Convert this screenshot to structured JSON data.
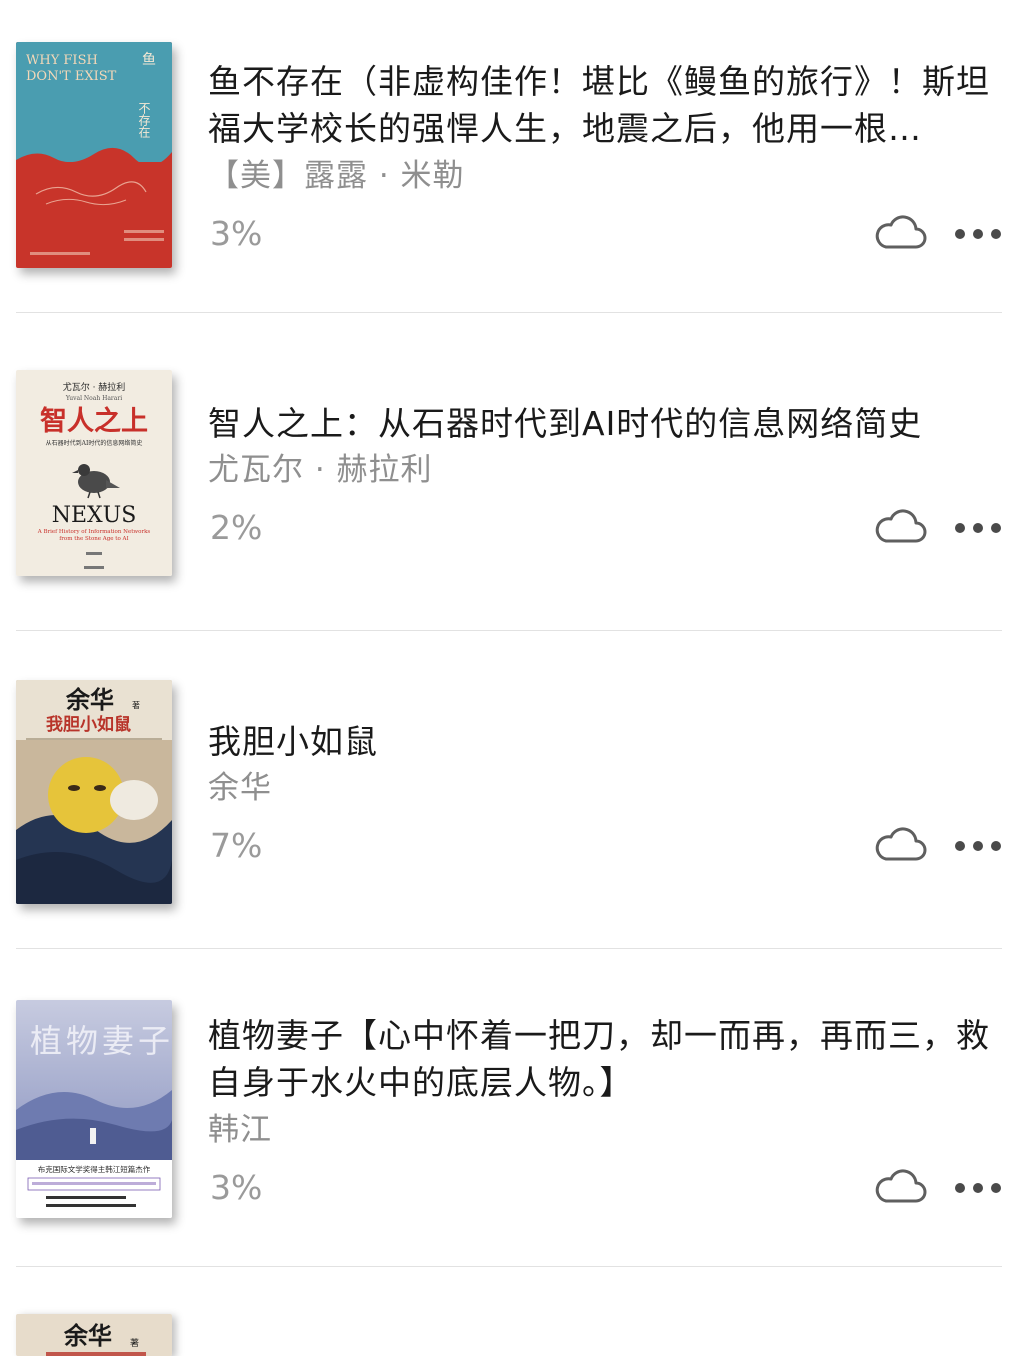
{
  "books": [
    {
      "title": "鱼不存在（非虚构佳作！堪比《鳗鱼的旅行》！斯坦福大学校长的强悍人生，地震之后，他用一根…",
      "author": "【美】露露 · 米勒",
      "progress": "3%",
      "cover": {
        "title_en_line1": "WHY FISH",
        "title_en_line2": "DON'T EXIST",
        "title_zh_line1": "鱼",
        "title_zh_line2": "不存在",
        "top_color": "#4a9db0",
        "bottom_color": "#c8342a"
      }
    },
    {
      "title": "智人之上：从石器时代到AI时代的信息网络简史",
      "author": "尤瓦尔 · 赫拉利",
      "progress": "2%",
      "cover": {
        "author_zh": "尤瓦尔 · 赫拉利",
        "author_en": "Yuval Noah Harari",
        "title_zh": "智人之上",
        "subtitle_zh": "从石器时代到AI时代的信息网络简史",
        "title_en": "NEXUS",
        "subtitle_en_line1": "A Brief History of Information Networks",
        "subtitle_en_line2": "from the Stone Age to AI",
        "background": "#f2ece1",
        "accent": "#c8302a"
      }
    },
    {
      "title": "我胆小如鼠",
      "author": "余华",
      "progress": "7%",
      "cover": {
        "author_zh": "余华",
        "author_suffix": "著",
        "title_zh": "我胆小如鼠",
        "background": "#c9b79c",
        "accent": "#b8342a"
      }
    },
    {
      "title": "植物妻子【心中怀着一把刀，却一而再，再而三，救自身于水火中的底层人物。】",
      "author": "韩江",
      "progress": "3%",
      "cover": {
        "title_zh": "植物妻子",
        "blurb_line1": "布克国际文学奖得主韩江短篇杰作",
        "background": "#aeb6d4"
      }
    },
    {
      "cover": {
        "author_zh": "余华",
        "author_suffix": "著",
        "background": "#e7dccb"
      }
    }
  ],
  "icons": {
    "cloud": "cloud-icon",
    "more": "more-horizontal-icon"
  }
}
